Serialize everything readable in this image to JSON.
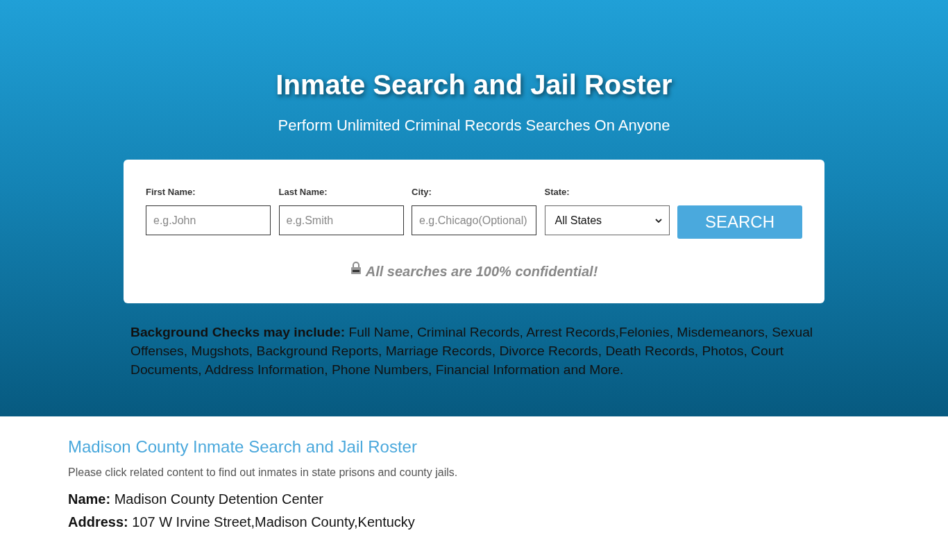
{
  "header": {
    "title": "Inmate Search and Jail Roster",
    "subtitle": "Perform Unlimited Criminal Records Searches On Anyone"
  },
  "search_form": {
    "fields": [
      {
        "kind": "text",
        "label": "First Name:",
        "placeholder": "e.g.John"
      },
      {
        "kind": "text",
        "label": "Last Name:",
        "placeholder": "e.g.Smith"
      },
      {
        "kind": "text",
        "label": "City:",
        "placeholder": "e.g.Chicago(Optional)"
      },
      {
        "kind": "select",
        "label": "State:",
        "value": "All States"
      }
    ],
    "button": "SEARCH",
    "notice": "All searches are 100% confidential!"
  },
  "background_checks": "**Background Checks may include:** Full Name, Criminal Records, Arrest Records,Felonies, Misdemeanors, Sexual Offenses, Mugshots, Background Reports, Marriage Records, Divorce Records, Death Records, Photos, Court Documents, Address Information, Phone Numbers, Financial Information and More.",
  "facility": {
    "title": "Madison County Inmate Search and Jail Roster",
    "intro": "Please click related content to find out inmates in state prisons and county jails.",
    "details": [
      "**Name:** Madison County Detention Center",
      "**Address:** 107 W Irvine Street,Madison County,Kentucky"
    ]
  }
}
